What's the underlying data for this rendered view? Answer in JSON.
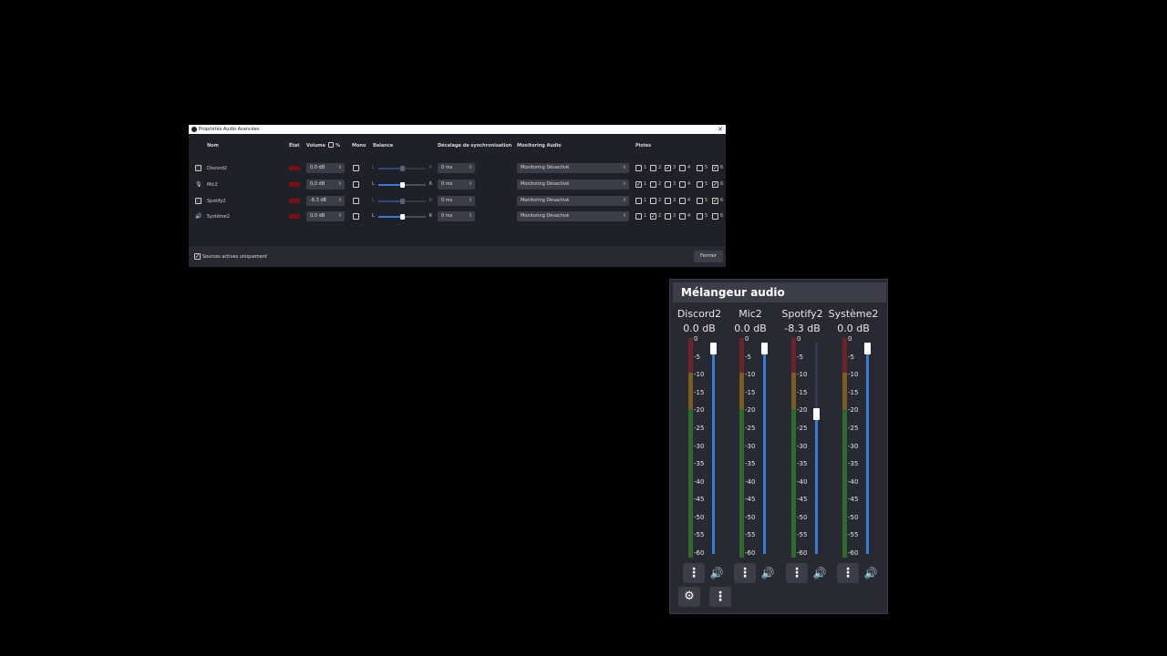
{
  "advanced_audio": {
    "title": "Propriétés Audio Avancées",
    "close_glyph": "✕",
    "headers": {
      "name": "Nom",
      "state": "État",
      "volume": "Volume",
      "percent": "%",
      "mono": "Mono",
      "balance": "Balance",
      "sync_offset": "Décalage de synchronisation",
      "monitoring": "Monitoring Audio",
      "tracks": "Pistes"
    },
    "balance_left": "L",
    "balance_right": "R",
    "rows": [
      {
        "name": "Discord2",
        "icon": "capture-icon",
        "volume": "0,0 dB",
        "mono": false,
        "balance": 0.5,
        "balance_enabled": false,
        "sync": "0 ms",
        "monitoring": "Monitoring Désactivé",
        "tracks": [
          false,
          false,
          true,
          false,
          false,
          true
        ]
      },
      {
        "name": "Mic2",
        "icon": "microphone-icon",
        "volume": "0,0 dB",
        "mono": false,
        "balance": 0.5,
        "balance_enabled": true,
        "sync": "0 ms",
        "monitoring": "Monitoring Désactivé",
        "tracks": [
          true,
          false,
          false,
          false,
          false,
          true
        ]
      },
      {
        "name": "Spotify2",
        "icon": "capture-icon",
        "volume": "-8,3 dB",
        "mono": false,
        "balance": 0.5,
        "balance_enabled": false,
        "sync": "0 ms",
        "monitoring": "Monitoring Désactivé",
        "tracks": [
          false,
          false,
          false,
          false,
          false,
          true
        ]
      },
      {
        "name": "Système2",
        "icon": "speaker-icon",
        "volume": "0,0 dB",
        "mono": false,
        "balance": 0.5,
        "balance_enabled": true,
        "sync": "0 ms",
        "monitoring": "Monitoring Désactivé",
        "tracks": [
          false,
          true,
          false,
          false,
          false,
          false
        ]
      }
    ],
    "track_numbers": [
      "1",
      "2",
      "3",
      "4",
      "5",
      "6"
    ],
    "active_only_label": "Sources actives uniquement",
    "active_only_checked": true,
    "close_button": "Fermer"
  },
  "mixer": {
    "title": "Mélangeur audio",
    "scale": [
      "0",
      "-5",
      "-10",
      "-15",
      "-20",
      "-25",
      "-30",
      "-35",
      "-40",
      "-45",
      "-50",
      "-55",
      "-60"
    ],
    "channels": [
      {
        "name": "Discord2",
        "db": "0.0 dB",
        "level": 1.0
      },
      {
        "name": "Mic2",
        "db": "0.0 dB",
        "level": 1.0
      },
      {
        "name": "Spotify2",
        "db": "-8.3 dB",
        "level": 0.69
      },
      {
        "name": "Système2",
        "db": "0.0 dB",
        "level": 1.0
      }
    ],
    "menu_glyph": "⋮",
    "volume_glyph": "🔊",
    "gear_glyph": "⚙"
  },
  "colors": {
    "accent_blue": "#3a7ad8",
    "meter_red": "#6b2229",
    "meter_yellow": "#7a5d1f",
    "meter_green": "#2e6a2b",
    "state_red": "#7a0f14"
  }
}
